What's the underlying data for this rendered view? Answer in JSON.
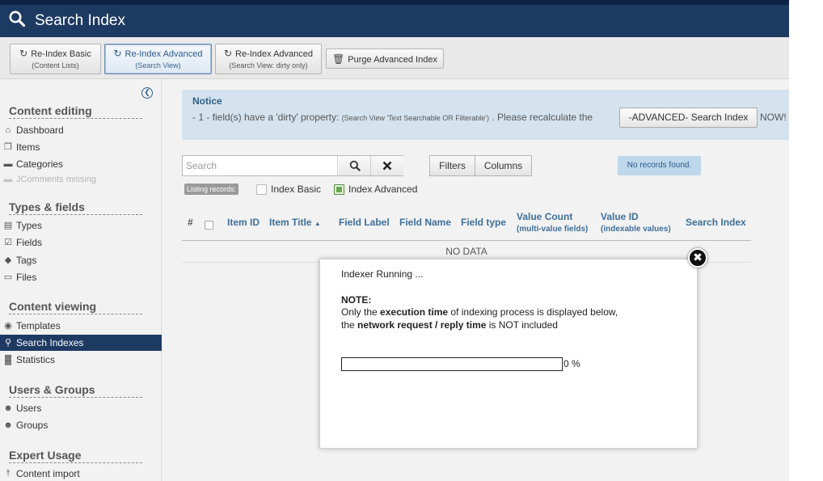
{
  "header": {
    "title": "Search Index",
    "icon": "search-icon"
  },
  "toolbar": {
    "reindex_basic": {
      "label": "Re-Index Basic",
      "sub": "(Content Lists)"
    },
    "reindex_advanced": {
      "label": "Re-Index Advanced",
      "sub": "(Search View)"
    },
    "reindex_advanced_dirty": {
      "label": "Re-Index Advanced",
      "sub": "(Search View: dirty only)"
    },
    "purge": {
      "label": "Purge Advanced Index"
    }
  },
  "sidebar": {
    "sections": [
      {
        "title": "Content editing",
        "items": [
          {
            "label": "Dashboard",
            "icon": "home-icon"
          },
          {
            "label": "Items",
            "icon": "items-icon"
          },
          {
            "label": "Categories",
            "icon": "folder-icon"
          },
          {
            "label": "JComments missing",
            "icon": "comments-icon",
            "disabled": true
          }
        ]
      },
      {
        "title": "Types & fields",
        "items": [
          {
            "label": "Types",
            "icon": "types-icon"
          },
          {
            "label": "Fields",
            "icon": "fields-icon"
          },
          {
            "label": "Tags",
            "icon": "tags-icon"
          },
          {
            "label": "Files",
            "icon": "files-icon"
          }
        ]
      },
      {
        "title": "Content viewing",
        "items": [
          {
            "label": "Templates",
            "icon": "eye-icon"
          },
          {
            "label": "Search Indexes",
            "icon": "search-icon",
            "selected": true
          },
          {
            "label": "Statistics",
            "icon": "chart-icon"
          }
        ]
      },
      {
        "title": "Users & Groups",
        "items": [
          {
            "label": "Users",
            "icon": "user-icon"
          },
          {
            "label": "Groups",
            "icon": "group-icon"
          }
        ]
      },
      {
        "title": "Expert Usage",
        "items": [
          {
            "label": "Content import",
            "icon": "import-icon"
          }
        ]
      }
    ]
  },
  "notice": {
    "title": "Notice",
    "text_a": "- 1 - field(s) have a 'dirty' property:",
    "text_small": "(Search View 'Text Searchable OR Filterable')",
    "text_b": ". Please recalculate the",
    "button": "-ADVANCED- Search Index",
    "tail": "NOW!"
  },
  "search": {
    "placeholder": "Search"
  },
  "filters": {
    "filters_label": "Filters",
    "columns_label": "Columns",
    "no_records": "No records found."
  },
  "listing": {
    "label": "Listing records:",
    "options": [
      {
        "label": "Index Basic",
        "checked": false
      },
      {
        "label": "Index Advanced",
        "checked": true
      }
    ]
  },
  "table": {
    "columns": {
      "num": "#",
      "item_id": "Item ID",
      "item_title": "Item Title",
      "field_label": "Field Label",
      "field_name": "Field Name",
      "field_type": "Field type",
      "value_count": "Value Count",
      "value_count_sub": "(multi-value fields)",
      "value_id": "Value ID",
      "value_id_sub": "(indexable values)",
      "search_index": "Search Index"
    },
    "empty": "NO DATA"
  },
  "modal": {
    "running": "Indexer Running ...",
    "note_title": "NOTE:",
    "line1_pre": "Only the",
    "line1_bold": "execution time",
    "line1_post": "of indexing process is displayed below,",
    "line2_pre": "the",
    "line2_bold": "network request / reply time",
    "line2_post": "is NOT included",
    "progress_percent": 0,
    "progress_label": "0 %"
  }
}
